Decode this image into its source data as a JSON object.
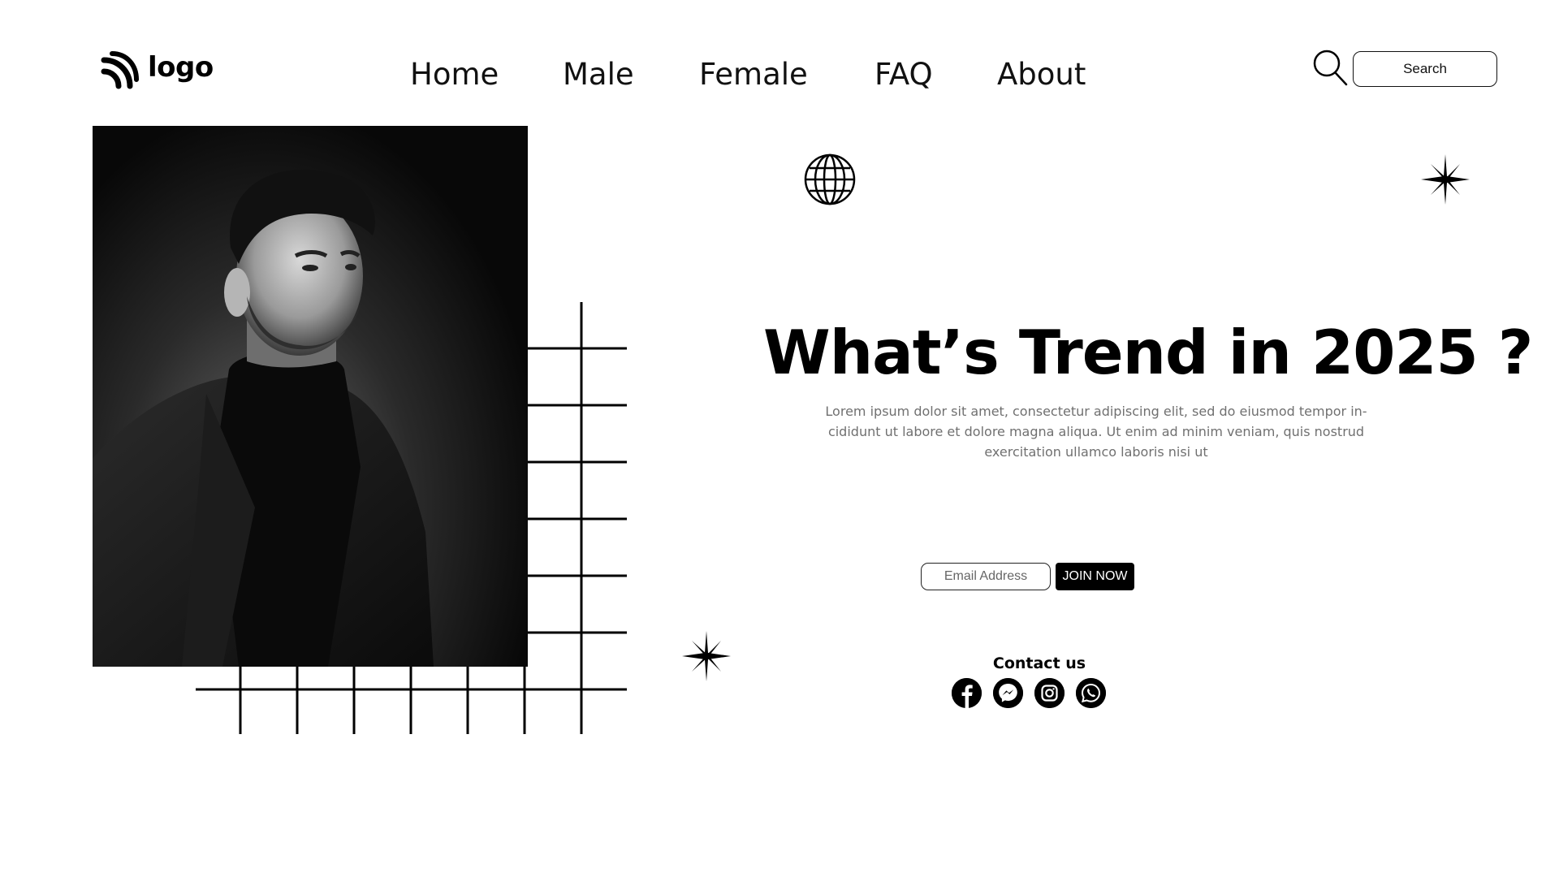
{
  "header": {
    "logo_text": "logo",
    "nav": [
      {
        "label": "Home"
      },
      {
        "label": "Male"
      },
      {
        "label": "Female"
      },
      {
        "label": "FAQ"
      },
      {
        "label": "About"
      }
    ],
    "search_placeholder": "Search"
  },
  "hero": {
    "title": "What’s Trend in 2025 ?",
    "description": "Lorem ipsum dolor sit amet, consectetur adipiscing elit, sed do eiusmod tempor in-cididunt ut labore et dolore magna aliqua. Ut enim ad minim veniam, quis nostrud exercitation ullamco laboris nisi ut"
  },
  "signup": {
    "email_placeholder": "Email Address",
    "button_label": "JOIN NOW"
  },
  "contact": {
    "title": "Contact us",
    "socials": [
      "facebook-icon",
      "messenger-icon",
      "instagram-icon",
      "whatsapp-icon"
    ]
  },
  "portrait": {
    "alt": "black-and-white portrait of a man in a dark jacket"
  },
  "colors": {
    "text": "#000000",
    "muted": "#707070",
    "background": "#ffffff"
  }
}
